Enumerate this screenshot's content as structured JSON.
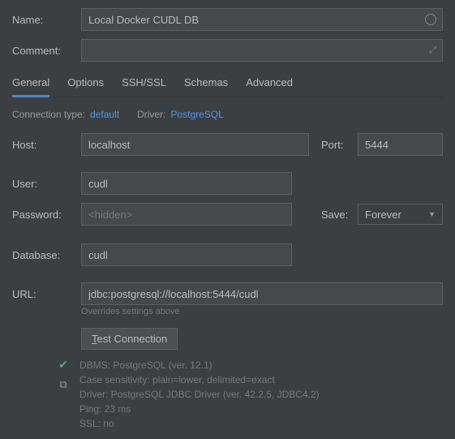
{
  "name": {
    "label": "Name:",
    "value": "Local Docker CUDL DB"
  },
  "comment": {
    "label": "Comment:",
    "value": ""
  },
  "tabs": {
    "general": "General",
    "options": "Options",
    "sshssl": "SSH/SSL",
    "schemas": "Schemas",
    "advanced": "Advanced"
  },
  "meta": {
    "conn_type_label": "Connection type:",
    "conn_type_value": "default",
    "driver_label": "Driver:",
    "driver_value": "PostgreSQL"
  },
  "host": {
    "label": "Host:",
    "value": "localhost"
  },
  "port": {
    "label": "Port:",
    "value": "5444"
  },
  "user": {
    "label": "User:",
    "value": "cudl"
  },
  "password": {
    "label": "Password:",
    "placeholder": "<hidden>",
    "value": ""
  },
  "save": {
    "label": "Save:",
    "value": "Forever"
  },
  "database": {
    "label": "Database:",
    "value": "cudl"
  },
  "url": {
    "label": "URL:",
    "value": "jdbc:postgresql://localhost:5444/cudl",
    "hint": "Overrides settings above"
  },
  "test_button_prefix": "T",
  "test_button_rest": "est Connection",
  "status": {
    "dbms": "DBMS: PostgreSQL (ver. 12.1)",
    "case": "Case sensitivity: plain=lower, delimited=exact",
    "driver": "Driver: PostgreSQL JDBC Driver (ver. 42.2.5, JDBC4.2)",
    "ping": "Ping: 23 ms",
    "ssl": "SSL: no"
  }
}
